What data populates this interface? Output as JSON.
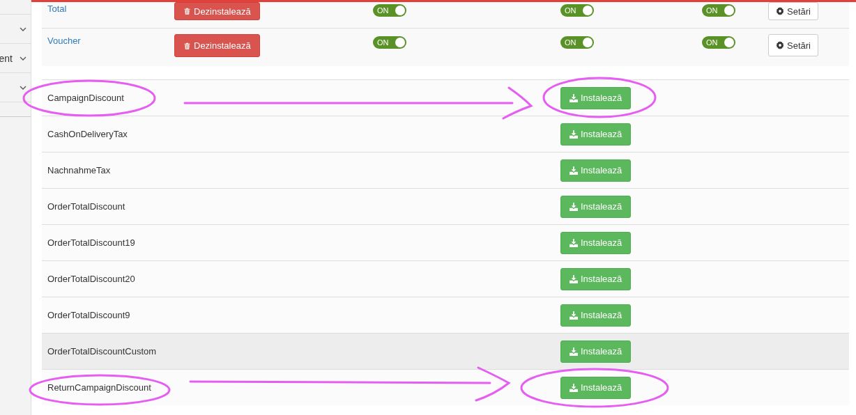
{
  "sidebar": {
    "items": [
      {
        "expanded": false
      },
      {
        "label": "ent",
        "expanded": false
      },
      {
        "expanded": false
      }
    ]
  },
  "installed_modules": [
    {
      "name": "Total",
      "uninstall_button": "Dezinstalează",
      "toggles": [
        {
          "label": "ON",
          "on": true
        },
        {
          "label": "ON",
          "on": true
        },
        {
          "label": "ON",
          "on": true
        }
      ],
      "settings_button": "Setări"
    },
    {
      "name": "Voucher",
      "uninstall_button": "Dezinstalează",
      "toggles": [
        {
          "label": "ON",
          "on": true
        },
        {
          "label": "ON",
          "on": true
        },
        {
          "label": "ON",
          "on": true
        }
      ],
      "settings_button": "Setări"
    }
  ],
  "available_modules": [
    {
      "name": "CampaignDiscount",
      "install_button": "Instalează",
      "highlighted": false
    },
    {
      "name": "CashOnDeliveryTax",
      "install_button": "Instalează",
      "highlighted": false
    },
    {
      "name": "NachnahmeTax",
      "install_button": "Instalează",
      "highlighted": false
    },
    {
      "name": "OrderTotalDiscount",
      "install_button": "Instalează",
      "highlighted": false
    },
    {
      "name": "OrderTotalDiscount19",
      "install_button": "Instalează",
      "highlighted": false
    },
    {
      "name": "OrderTotalDiscount20",
      "install_button": "Instalează",
      "highlighted": false
    },
    {
      "name": "OrderTotalDiscount9",
      "install_button": "Instalează",
      "highlighted": false
    },
    {
      "name": "OrderTotalDiscountCustom",
      "install_button": "Instalează",
      "highlighted": true
    },
    {
      "name": "ReturnCampaignDiscount",
      "install_button": "Instalează",
      "highlighted": false
    }
  ]
}
